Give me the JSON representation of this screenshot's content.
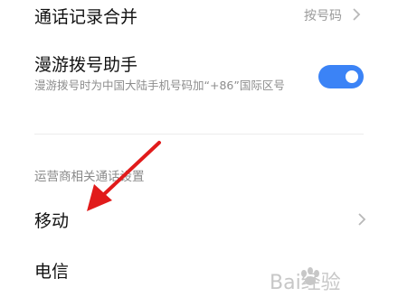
{
  "settings": {
    "call_log_merge": {
      "label": "通话记录合并",
      "value": "按号码"
    },
    "roaming_assistant": {
      "label": "漫游拨号助手",
      "description": "漫游拨号时为中国大陆手机号码加“+86”国际区号",
      "enabled": true
    },
    "carrier_section_header": "运营商相关通话设置",
    "carriers": [
      {
        "label": "移动"
      },
      {
        "label": "电信"
      }
    ]
  },
  "colors": {
    "accent": "#3b83f6",
    "annotation_arrow": "#e11b1b"
  },
  "watermark": {
    "text": "Bai经验",
    "icon": "paw-icon"
  }
}
